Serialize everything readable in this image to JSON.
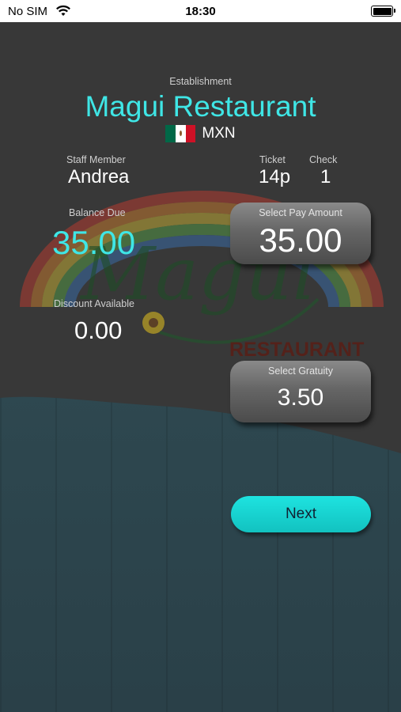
{
  "status_bar": {
    "carrier": "No SIM",
    "time": "18:30"
  },
  "header": {
    "establishment_label": "Establishment",
    "restaurant_name": "Magui Restaurant",
    "currency": "MXN"
  },
  "staff": {
    "label": "Staff Member",
    "value": "Andrea"
  },
  "ticket": {
    "label": "Ticket",
    "value": "14p"
  },
  "check": {
    "label": "Check",
    "value": "1"
  },
  "balance": {
    "label": "Balance Due",
    "value": "35.00"
  },
  "discount": {
    "label": "Discount Available",
    "value": "0.00"
  },
  "pay_amount": {
    "label": "Select Pay Amount",
    "value": "35.00"
  },
  "gratuity": {
    "label": "Select Gratuity",
    "value": "3.50"
  },
  "next_button": {
    "label": "Next"
  },
  "logo": {
    "word": "Magui",
    "subtitle": "RESTAURANT"
  },
  "colors": {
    "accent": "#3fe6e6",
    "button": "#14cfcc",
    "background": "#383838"
  }
}
